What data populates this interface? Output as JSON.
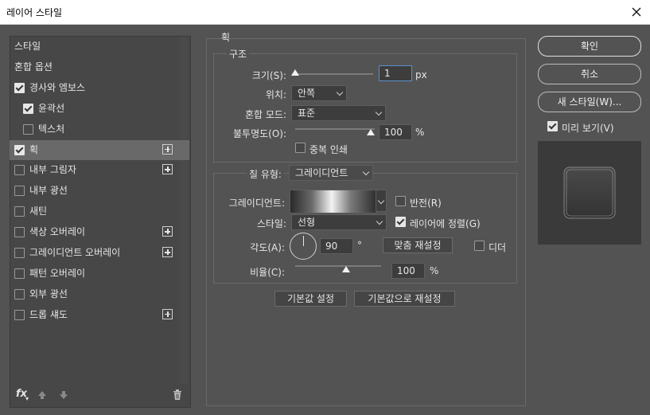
{
  "window": {
    "title": "레이어 스타일"
  },
  "styles_list": {
    "items": [
      {
        "label": "스타일",
        "checkbox": null,
        "checked": false,
        "plus": false,
        "selected": false,
        "indent": false
      },
      {
        "label": "혼합 옵션",
        "checkbox": null,
        "checked": false,
        "plus": false,
        "selected": false,
        "indent": false
      },
      {
        "label": "경사와 엠보스",
        "checkbox": true,
        "checked": true,
        "plus": false,
        "selected": false,
        "indent": false
      },
      {
        "label": "윤곽선",
        "checkbox": true,
        "checked": true,
        "plus": false,
        "selected": false,
        "indent": true
      },
      {
        "label": "텍스처",
        "checkbox": true,
        "checked": false,
        "plus": false,
        "selected": false,
        "indent": true
      },
      {
        "label": "획",
        "checkbox": true,
        "checked": true,
        "plus": true,
        "selected": true,
        "indent": false
      },
      {
        "label": "내부 그림자",
        "checkbox": true,
        "checked": false,
        "plus": true,
        "selected": false,
        "indent": false
      },
      {
        "label": "내부 광선",
        "checkbox": true,
        "checked": false,
        "plus": false,
        "selected": false,
        "indent": false
      },
      {
        "label": "새틴",
        "checkbox": true,
        "checked": false,
        "plus": false,
        "selected": false,
        "indent": false
      },
      {
        "label": "색상 오버레이",
        "checkbox": true,
        "checked": false,
        "plus": true,
        "selected": false,
        "indent": false
      },
      {
        "label": "그레이디언트 오버레이",
        "checkbox": true,
        "checked": false,
        "plus": true,
        "selected": false,
        "indent": false
      },
      {
        "label": "패턴 오버레이",
        "checkbox": true,
        "checked": false,
        "plus": false,
        "selected": false,
        "indent": false
      },
      {
        "label": "외부 광선",
        "checkbox": true,
        "checked": false,
        "plus": false,
        "selected": false,
        "indent": false
      },
      {
        "label": "드롭 섀도",
        "checkbox": true,
        "checked": false,
        "plus": true,
        "selected": false,
        "indent": false
      }
    ],
    "bottom": {
      "fx_label": "fx"
    }
  },
  "stroke": {
    "section_title": "획",
    "structure": {
      "legend": "구조",
      "size_label": "크기(S):",
      "size_value": "1",
      "size_unit": "px",
      "position_label": "위치:",
      "position_value": "안쪽",
      "blend_label": "혼합 모드:",
      "blend_value": "표준",
      "opacity_label": "불투명도(O):",
      "opacity_value": "100",
      "opacity_unit": "%",
      "opacity_fraction": 1.0,
      "size_fraction": 0.0,
      "overprint_label": "중복 인쇄",
      "overprint_checked": false
    },
    "fill": {
      "fill_type_label": "칠 유형:",
      "fill_type_value": "그레이디언트",
      "gradient_label": "그레이디언트:",
      "reverse_label": "반전(R)",
      "reverse_checked": false,
      "style_label": "스타일:",
      "style_value": "선형",
      "align_label": "레이어에 정렬(G)",
      "align_checked": true,
      "angle_label": "각도(A):",
      "angle_value": "90",
      "angle_unit": "°",
      "reset_align_button": "맞춤 재설정",
      "dither_label": "디더",
      "dither_checked": false,
      "scale_label": "비율(C):",
      "scale_value": "100",
      "scale_unit": "%",
      "scale_fraction": 0.5
    },
    "make_default": "기본값 설정",
    "reset_default": "기본값으로 재설정"
  },
  "actions": {
    "ok": "확인",
    "cancel": "취소",
    "new_style": "새 스타일(W)...",
    "preview_label": "미리 보기(V)",
    "preview_checked": true
  }
}
